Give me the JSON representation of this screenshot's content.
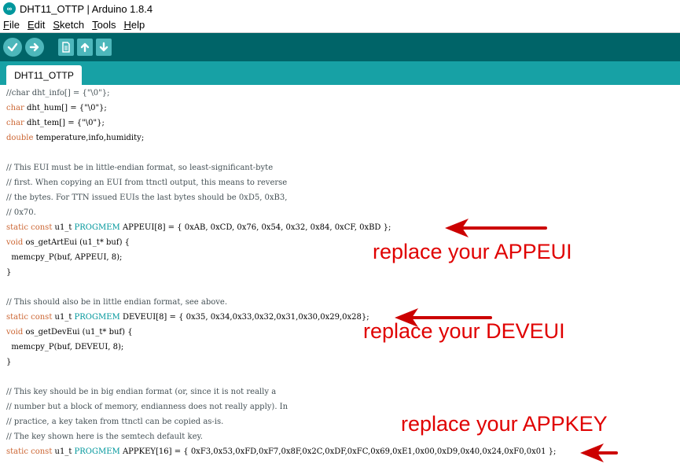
{
  "window": {
    "title": "DHT11_OTTP | Arduino 1.8.4",
    "app_icon_glyph": "∞"
  },
  "menu": {
    "items": [
      {
        "label": "File",
        "accel": "F",
        "rest": "ile"
      },
      {
        "label": "Edit",
        "accel": "E",
        "rest": "dit"
      },
      {
        "label": "Sketch",
        "accel": "S",
        "rest": "ketch"
      },
      {
        "label": "Tools",
        "accel": "T",
        "rest": "ools"
      },
      {
        "label": "Help",
        "accel": "H",
        "rest": "elp"
      }
    ]
  },
  "toolbar": {
    "buttons": [
      {
        "name": "verify-button",
        "icon": "check-icon"
      },
      {
        "name": "upload-button",
        "icon": "arrow-right-icon"
      },
      {
        "name": "new-button",
        "icon": "new-file-icon"
      },
      {
        "name": "open-button",
        "icon": "arrow-up-icon"
      },
      {
        "name": "save-button",
        "icon": "arrow-down-icon"
      }
    ]
  },
  "tabs": [
    {
      "label": "DHT11_OTTP",
      "active": true
    }
  ],
  "code": {
    "lines": [
      "//char dht_info[] = {\"\\0\"};",
      "char dht_hum[] = {\"\\0\"};",
      "char dht_tem[] = {\"\\0\"};",
      "double temperature,info,humidity;",
      "",
      "// This EUI must be in little-endian format, so least-significant-byte",
      "// first. When copying an EUI from ttnctl output, this means to reverse",
      "// the bytes. For TTN issued EUIs the last bytes should be 0xD5, 0xB3,",
      "// 0x70.",
      "static const u1_t PROGMEM APPEUI[8] = { 0xAB, 0xCD, 0x76, 0x54, 0x32, 0x84, 0xCF, 0xBD };",
      "void os_getArtEui (u1_t* buf) {",
      "  memcpy_P(buf, APPEUI, 8);",
      "}",
      "",
      "// This should also be in little endian format, see above.",
      "static const u1_t PROGMEM DEVEUI[8] = { 0x35, 0x34,0x33,0x32,0x31,0x30,0x29,0x28};",
      "void os_getDevEui (u1_t* buf) {",
      "  memcpy_P(buf, DEVEUI, 8);",
      "}",
      "",
      "// This key should be in big endian format (or, since it is not really a",
      "// number but a block of memory, endianness does not really apply). In",
      "// practice, a key taken from ttnctl can be copied as-is.",
      "// The key shown here is the semtech default key.",
      "static const u1_t PROGMEM APPKEY[16] = { 0xF3,0x53,0xFD,0xF7,0x8F,0x2C,0xDF,0xFC,0x69,0xE1,0x00,0xD9,0x40,0x24,0xF0,0x01 };"
    ]
  },
  "annotations": [
    {
      "name": "annotation-appeui",
      "text": "replace your APPEUI"
    },
    {
      "name": "annotation-deveui",
      "text": "replace your DEVEUI"
    },
    {
      "name": "annotation-appkey",
      "text": "replace your APPKEY"
    }
  ],
  "colors": {
    "toolbar_bg": "#006468",
    "tabbar_bg": "#17a1a5",
    "button_bg": "#4db7bb",
    "keyword": "#cc6633",
    "type": "#00979c",
    "comment": "#434f54",
    "annotation": "#e00000"
  }
}
